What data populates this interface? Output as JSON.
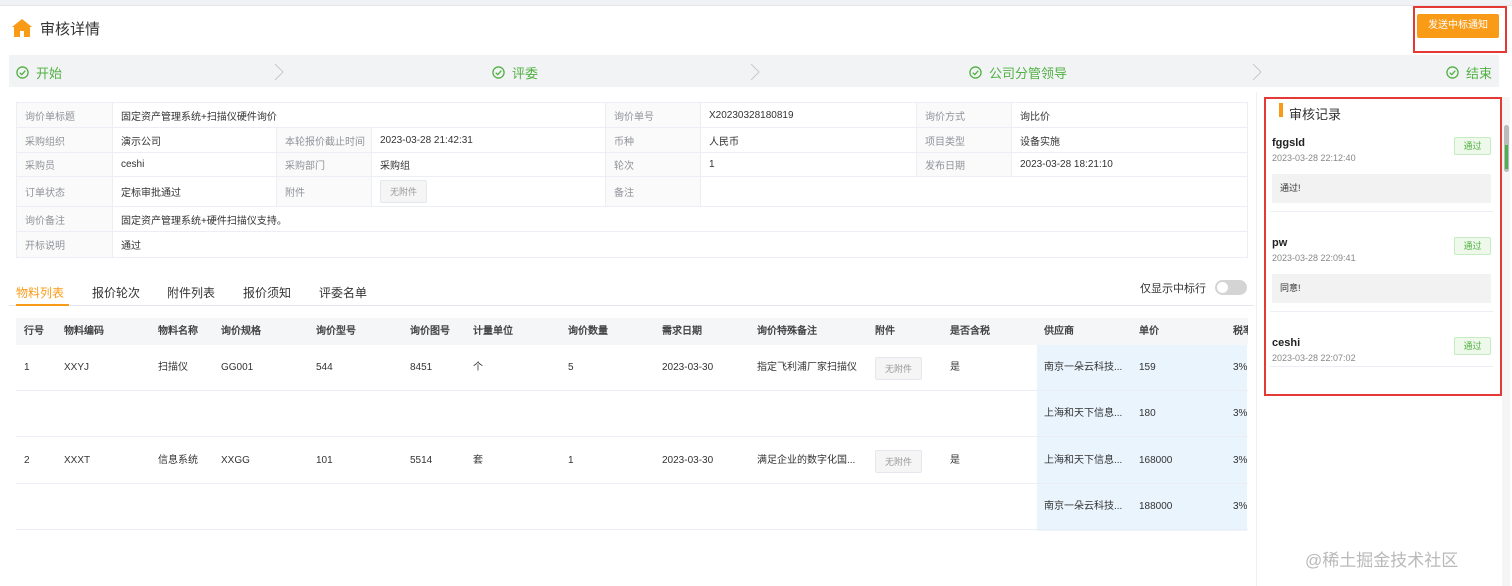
{
  "header": {
    "title": "审核详情",
    "notify_button": "发送中标通知"
  },
  "steps": [
    {
      "label": "开始"
    },
    {
      "label": "评委"
    },
    {
      "label": "公司分管领导"
    },
    {
      "label": "结束"
    }
  ],
  "info": {
    "inquiry_title_label": "询价单标题",
    "inquiry_title": "固定资产管理系统+扫描仪硬件询价",
    "inquiry_no_label": "询价单号",
    "inquiry_no": "X20230328180819",
    "method_label": "询价方式",
    "method": "询比价",
    "org_label": "采购组织",
    "org": "演示公司",
    "deadline_label": "本轮报价截止时间",
    "deadline": "2023-03-28 21:42:31",
    "currency_label": "币种",
    "currency": "人民币",
    "project_type_label": "项目类型",
    "project_type": "设备实施",
    "buyer_label": "采购员",
    "buyer": "ceshi",
    "dept_label": "采购部门",
    "dept": "采购组",
    "round_label": "轮次",
    "round": "1",
    "publish_label": "发布日期",
    "publish": "2023-03-28 18:21:10",
    "status_label": "订单状态",
    "status": "定标审批通过",
    "attachment_label": "附件",
    "attachment": "无附件",
    "remark_label": "备注",
    "remark": "",
    "inquiry_remark_label": "询价备注",
    "inquiry_remark": "固定资产管理系统+硬件扫描仪支持。",
    "bid_open_label": "开标说明",
    "bid_open": "通过"
  },
  "tabs": [
    "物料列表",
    "报价轮次",
    "附件列表",
    "报价须知",
    "评委名单"
  ],
  "only_winning_label": "仅显示中标行",
  "table": {
    "headers": [
      "行号",
      "物料编码",
      "物料名称",
      "询价规格",
      "询价型号",
      "询价图号",
      "计量单位",
      "询价数量",
      "需求日期",
      "询价特殊备注",
      "附件",
      "是否含税",
      "供应商",
      "单价",
      "税率"
    ],
    "rows": [
      {
        "no": "1",
        "code": "XXYJ",
        "name": "扫描仪",
        "spec": "GG001",
        "model": "544",
        "drawing": "8451",
        "unit": "个",
        "qty": "5",
        "date": "2023-03-30",
        "note": "指定飞利浦厂家扫描仪",
        "attachment": "无附件",
        "tax_included": "是",
        "supplier": "南京一朵云科技...",
        "price": "159",
        "tax": "3%"
      },
      {
        "no": "",
        "code": "",
        "name": "",
        "spec": "",
        "model": "",
        "drawing": "",
        "unit": "",
        "qty": "",
        "date": "",
        "note": "",
        "attachment": "",
        "tax_included": "",
        "supplier": "上海和天下信息...",
        "price": "180",
        "tax": "3%"
      },
      {
        "no": "2",
        "code": "XXXT",
        "name": "信息系统",
        "spec": "XXGG",
        "model": "101",
        "drawing": "5514",
        "unit": "套",
        "qty": "1",
        "date": "2023-03-30",
        "note": "满足企业的数字化国...",
        "attachment": "无附件",
        "tax_included": "是",
        "supplier": "上海和天下信息...",
        "price": "168000",
        "tax": "3%"
      },
      {
        "no": "",
        "code": "",
        "name": "",
        "spec": "",
        "model": "",
        "drawing": "",
        "unit": "",
        "qty": "",
        "date": "",
        "note": "",
        "attachment": "",
        "tax_included": "",
        "supplier": "南京一朵云科技...",
        "price": "188000",
        "tax": "3%"
      }
    ]
  },
  "records": {
    "title": "审核记录",
    "items": [
      {
        "name": "fggsld",
        "time": "2023-03-28 22:12:40",
        "badge": "通过",
        "comment": "通过!"
      },
      {
        "name": "pw",
        "time": "2023-03-28 22:09:41",
        "badge": "通过",
        "comment": "同意!"
      },
      {
        "name": "ceshi",
        "time": "2023-03-28 22:07:02",
        "badge": "通过",
        "comment": ""
      }
    ]
  },
  "watermark": "@稀土掘金技术社区",
  "colors": {
    "accent": "#fa9b17",
    "success": "#52b043",
    "highlight_border": "#e53935",
    "supplier_bg": "#eaf4fd"
  }
}
